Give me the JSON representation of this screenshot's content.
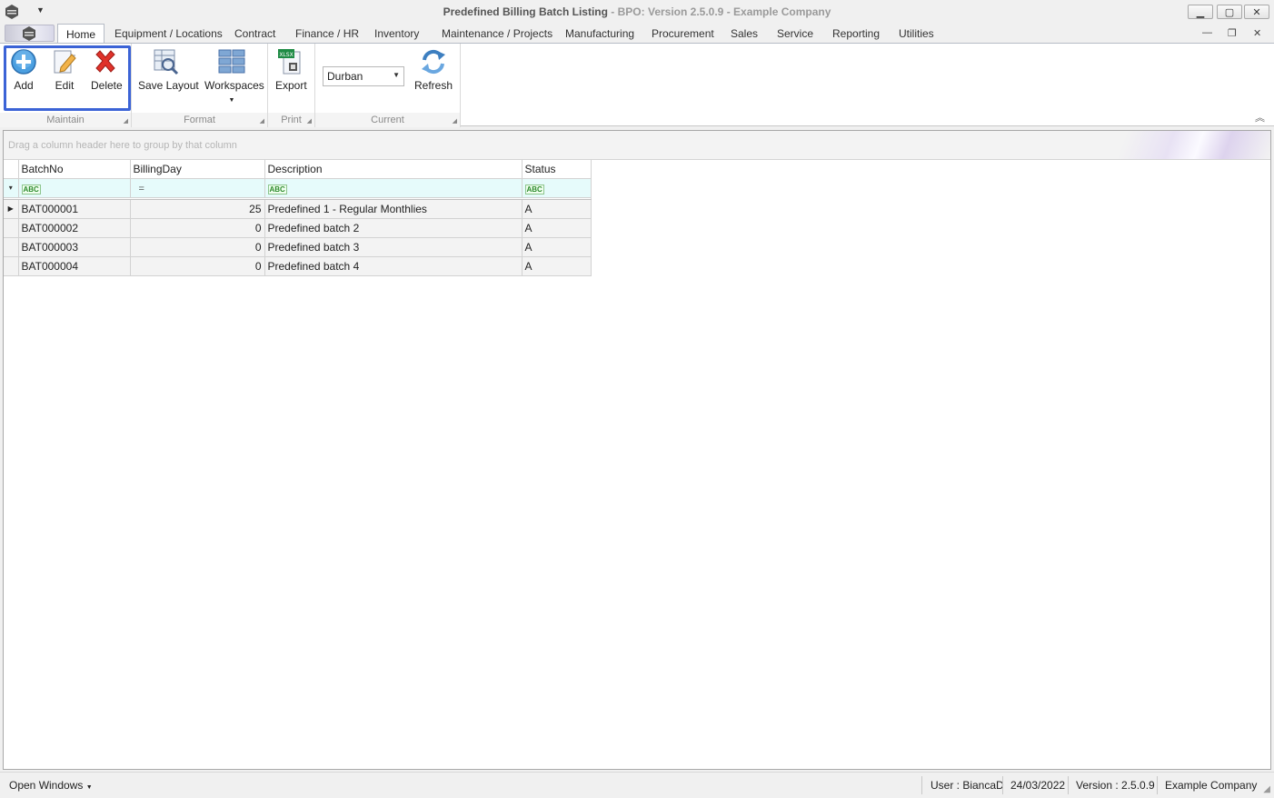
{
  "window": {
    "title_main": "Predefined Billing Batch Listing",
    "title_sub": "BPO: Version 2.5.0.9 - Example Company"
  },
  "tabs": [
    {
      "label": "Home",
      "active": true
    },
    {
      "label": "Equipment / Locations"
    },
    {
      "label": "Contract"
    },
    {
      "label": "Finance / HR"
    },
    {
      "label": "Inventory"
    },
    {
      "label": "Maintenance / Projects"
    },
    {
      "label": "Manufacturing"
    },
    {
      "label": "Procurement"
    },
    {
      "label": "Sales"
    },
    {
      "label": "Service"
    },
    {
      "label": "Reporting"
    },
    {
      "label": "Utilities"
    }
  ],
  "ribbon": {
    "maintain": {
      "label": "Maintain",
      "add": "Add",
      "edit": "Edit",
      "delete": "Delete"
    },
    "format": {
      "label": "Format",
      "save_layout": "Save Layout",
      "workspaces": "Workspaces"
    },
    "print": {
      "label": "Print",
      "export": "Export"
    },
    "current": {
      "label": "Current",
      "location_value": "Durban",
      "refresh": "Refresh"
    }
  },
  "grid": {
    "group_hint": "Drag a column header here to group by that column",
    "columns": [
      "BatchNo",
      "BillingDay",
      "Description",
      "Status"
    ],
    "filter_icons": [
      "abc-filter-icon",
      "equals-filter-icon",
      "abc-filter-icon",
      "abc-filter-icon"
    ],
    "rows": [
      {
        "batch_no": "BAT000001",
        "billing_day": "25",
        "description": "Predefined 1 - Regular Monthlies",
        "status": "A"
      },
      {
        "batch_no": "BAT000002",
        "billing_day": "0",
        "description": "Predefined batch 2",
        "status": "A"
      },
      {
        "batch_no": "BAT000003",
        "billing_day": "0",
        "description": "Predefined batch 3",
        "status": "A"
      },
      {
        "batch_no": "BAT000004",
        "billing_day": "0",
        "description": "Predefined batch 4",
        "status": "A"
      }
    ]
  },
  "statusbar": {
    "open_windows": "Open Windows",
    "user": "User : BiancaD",
    "date": "24/03/2022",
    "version": "Version : 2.5.0.9",
    "company": "Example Company"
  },
  "colors": {
    "highlight": "#3b63d6",
    "filter_row": "#e6fbfb"
  }
}
